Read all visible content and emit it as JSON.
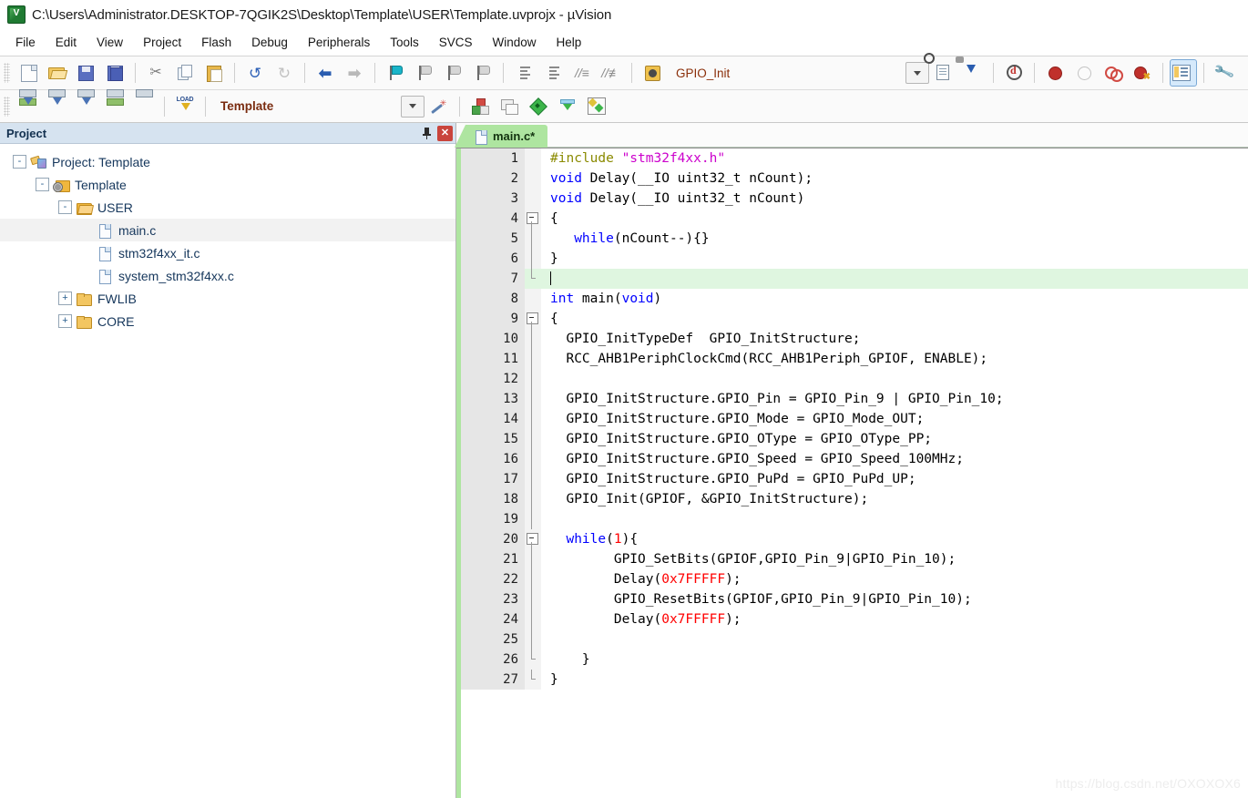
{
  "window": {
    "title": "C:\\Users\\Administrator.DESKTOP-7QGIK2S\\Desktop\\Template\\USER\\Template.uvprojx - µVision",
    "app_icon": "uvision-icon"
  },
  "menubar": {
    "items": [
      {
        "label": "File"
      },
      {
        "label": "Edit"
      },
      {
        "label": "View"
      },
      {
        "label": "Project"
      },
      {
        "label": "Flash"
      },
      {
        "label": "Debug"
      },
      {
        "label": "Peripherals"
      },
      {
        "label": "Tools"
      },
      {
        "label": "SVCS"
      },
      {
        "label": "Window"
      },
      {
        "label": "Help"
      }
    ]
  },
  "toolbar_main": {
    "function_combo_value": "GPIO_Init",
    "icons": [
      "new-file-icon",
      "open-file-icon",
      "save-icon",
      "save-all-icon",
      "cut-icon",
      "copy-icon",
      "paste-icon",
      "undo-icon",
      "redo-icon",
      "navigate-back-icon",
      "navigate-forward-icon",
      "bookmark-toggle-icon",
      "bookmark-prev-icon",
      "bookmark-next-icon",
      "bookmark-clear-icon",
      "indent-icon",
      "outdent-icon",
      "comment-icon",
      "uncomment-icon",
      "find-in-files-icon",
      "combo-dropdown-icon",
      "browse-symbol-icon",
      "goto-definition-icon",
      "debug-session-icon",
      "insert-breakpoint-icon",
      "disable-breakpoint-icon",
      "kill-all-breakpoints-icon",
      "disable-all-breakpoints-icon",
      "window-layout-icon",
      "configure-icon"
    ]
  },
  "toolbar_build": {
    "target_combo_value": "Template",
    "icons": [
      "translate-icon",
      "build-icon",
      "rebuild-icon",
      "batch-build-icon",
      "stop-build-icon",
      "load-icon",
      "target-combo-dropdown-icon",
      "target-options-wizard-icon",
      "manage-project-items-icon",
      "multi-project-icon",
      "configure-target-icon",
      "configure-filter-icon",
      "manage-run-time-env-icon"
    ]
  },
  "project_panel": {
    "title": "Project",
    "pin_icon": "pin-icon",
    "close_icon": "close-icon",
    "tree": [
      {
        "label": "Project: Template",
        "depth": 0,
        "expander": "-",
        "icon": "project-icon",
        "selected": false
      },
      {
        "label": "Template",
        "depth": 1,
        "expander": "-",
        "icon": "target-group-icon",
        "selected": false
      },
      {
        "label": "USER",
        "depth": 2,
        "expander": "-",
        "icon": "folder-open-icon",
        "selected": false
      },
      {
        "label": "main.c",
        "depth": 3,
        "expander": "",
        "icon": "file-icon",
        "selected": true
      },
      {
        "label": "stm32f4xx_it.c",
        "depth": 3,
        "expander": "",
        "icon": "file-icon",
        "selected": false
      },
      {
        "label": "system_stm32f4xx.c",
        "depth": 3,
        "expander": "",
        "icon": "file-icon",
        "selected": false
      },
      {
        "label": "FWLIB",
        "depth": 2,
        "expander": "+",
        "icon": "folder-icon",
        "selected": false
      },
      {
        "label": "CORE",
        "depth": 2,
        "expander": "+",
        "icon": "folder-icon",
        "selected": false
      }
    ]
  },
  "editor": {
    "tabs": [
      {
        "label": "main.c*",
        "icon": "file-icon",
        "active": true
      }
    ],
    "current_line": 7,
    "lines": [
      {
        "n": 1,
        "fold": "",
        "tokens": [
          {
            "t": "#include ",
            "c": "pp"
          },
          {
            "t": "\"stm32f4xx.h\"",
            "c": "str"
          }
        ]
      },
      {
        "n": 2,
        "fold": "",
        "tokens": [
          {
            "t": "void",
            "c": "k"
          },
          {
            "t": " Delay(__IO uint32_t nCount);",
            "c": ""
          }
        ]
      },
      {
        "n": 3,
        "fold": "",
        "tokens": [
          {
            "t": "void",
            "c": "k"
          },
          {
            "t": " Delay(__IO uint32_t nCount)",
            "c": ""
          }
        ]
      },
      {
        "n": 4,
        "fold": "start",
        "tokens": [
          {
            "t": "{",
            "c": ""
          }
        ]
      },
      {
        "n": 5,
        "fold": "mid",
        "tokens": [
          {
            "t": "   ",
            "c": ""
          },
          {
            "t": "while",
            "c": "k"
          },
          {
            "t": "(nCount--){}",
            "c": ""
          }
        ]
      },
      {
        "n": 6,
        "fold": "mid",
        "tokens": [
          {
            "t": "}",
            "c": ""
          }
        ]
      },
      {
        "n": 7,
        "fold": "end",
        "tokens": [
          {
            "t": "",
            "c": "caret"
          }
        ]
      },
      {
        "n": 8,
        "fold": "",
        "tokens": [
          {
            "t": "int",
            "c": "k"
          },
          {
            "t": " main(",
            "c": ""
          },
          {
            "t": "void",
            "c": "k"
          },
          {
            "t": ")",
            "c": ""
          }
        ]
      },
      {
        "n": 9,
        "fold": "start",
        "tokens": [
          {
            "t": "{",
            "c": ""
          }
        ]
      },
      {
        "n": 10,
        "fold": "mid",
        "tokens": [
          {
            "t": "  GPIO_InitTypeDef  GPIO_InitStructure;",
            "c": ""
          }
        ]
      },
      {
        "n": 11,
        "fold": "mid",
        "tokens": [
          {
            "t": "  RCC_AHB1PeriphClockCmd(RCC_AHB1Periph_GPIOF, ENABLE);",
            "c": ""
          }
        ]
      },
      {
        "n": 12,
        "fold": "mid",
        "tokens": [
          {
            "t": "",
            "c": ""
          }
        ]
      },
      {
        "n": 13,
        "fold": "mid",
        "tokens": [
          {
            "t": "  GPIO_InitStructure.GPIO_Pin = GPIO_Pin_9 | GPIO_Pin_10;",
            "c": ""
          }
        ]
      },
      {
        "n": 14,
        "fold": "mid",
        "tokens": [
          {
            "t": "  GPIO_InitStructure.GPIO_Mode = GPIO_Mode_OUT;",
            "c": ""
          }
        ]
      },
      {
        "n": 15,
        "fold": "mid",
        "tokens": [
          {
            "t": "  GPIO_InitStructure.GPIO_OType = GPIO_OType_PP;",
            "c": ""
          }
        ]
      },
      {
        "n": 16,
        "fold": "mid",
        "tokens": [
          {
            "t": "  GPIO_InitStructure.GPIO_Speed = GPIO_Speed_100MHz;",
            "c": ""
          }
        ]
      },
      {
        "n": 17,
        "fold": "mid",
        "tokens": [
          {
            "t": "  GPIO_InitStructure.GPIO_PuPd = GPIO_PuPd_UP;",
            "c": ""
          }
        ]
      },
      {
        "n": 18,
        "fold": "mid",
        "tokens": [
          {
            "t": "  GPIO_Init(GPIOF, &GPIO_InitStructure);",
            "c": ""
          }
        ]
      },
      {
        "n": 19,
        "fold": "mid",
        "tokens": [
          {
            "t": "",
            "c": ""
          }
        ]
      },
      {
        "n": 20,
        "fold": "start2",
        "tokens": [
          {
            "t": "  ",
            "c": ""
          },
          {
            "t": "while",
            "c": "k"
          },
          {
            "t": "(",
            "c": ""
          },
          {
            "t": "1",
            "c": "num"
          },
          {
            "t": "){",
            "c": ""
          }
        ]
      },
      {
        "n": 21,
        "fold": "mid2",
        "tokens": [
          {
            "t": "        GPIO_SetBits(GPIOF,GPIO_Pin_9|GPIO_Pin_10);",
            "c": ""
          }
        ]
      },
      {
        "n": 22,
        "fold": "mid2",
        "tokens": [
          {
            "t": "        Delay(",
            "c": ""
          },
          {
            "t": "0x7FFFFF",
            "c": "num"
          },
          {
            "t": ");",
            "c": ""
          }
        ]
      },
      {
        "n": 23,
        "fold": "mid2",
        "tokens": [
          {
            "t": "        GPIO_ResetBits(GPIOF,GPIO_Pin_9|GPIO_Pin_10);",
            "c": ""
          }
        ]
      },
      {
        "n": 24,
        "fold": "mid2",
        "tokens": [
          {
            "t": "        Delay(",
            "c": ""
          },
          {
            "t": "0x7FFFFF",
            "c": "num"
          },
          {
            "t": ");",
            "c": ""
          }
        ]
      },
      {
        "n": 25,
        "fold": "mid2",
        "tokens": [
          {
            "t": "",
            "c": ""
          }
        ]
      },
      {
        "n": 26,
        "fold": "end2",
        "tokens": [
          {
            "t": "    }",
            "c": ""
          }
        ]
      },
      {
        "n": 27,
        "fold": "end",
        "tokens": [
          {
            "t": "}",
            "c": ""
          }
        ]
      }
    ]
  },
  "watermark": "https://blog.csdn.net/OXOXOX6",
  "colors": {
    "tab_active": "#aee5a0",
    "current_line": "#dff6e0",
    "gutter": "#e6e6e6",
    "panel_header": "#d6e3f0",
    "keyword": "#0000ff",
    "string": "#cc00cc",
    "number": "#ff0000",
    "preprocessor": "#8a8a00",
    "toolbar_text": "#8b2f0a"
  }
}
